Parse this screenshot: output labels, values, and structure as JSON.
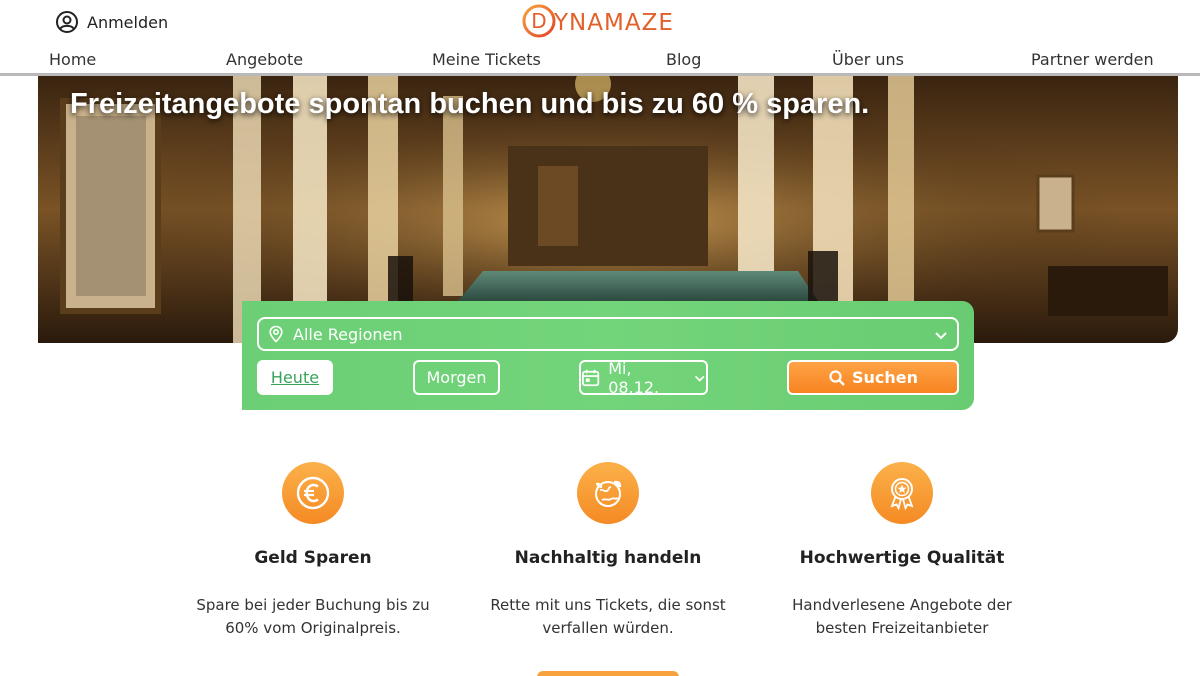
{
  "header": {
    "login_label": "Anmelden",
    "logo_text": "YNAMAZE",
    "logo_initial": "D"
  },
  "nav": {
    "items": [
      {
        "label": "Home",
        "active": true
      },
      {
        "label": "Angebote"
      },
      {
        "label": "Meine Tickets"
      },
      {
        "label": "Blog"
      },
      {
        "label": "Über uns"
      },
      {
        "label": "Partner werden"
      }
    ]
  },
  "hero": {
    "title": "Freizeitangebote spontan buchen und bis zu 60 % sparen."
  },
  "search": {
    "region_value": "Alle Regionen",
    "today_label": "Heute",
    "tomorrow_label": "Morgen",
    "date_label": "Mi, 08.12.",
    "search_label": "Suchen"
  },
  "features": [
    {
      "title": "Geld Sparen",
      "text_line1": "Spare bei jeder Buchung bis zu",
      "text_line2": "60% vom Originalpreis.",
      "icon": "euro-icon"
    },
    {
      "title": "Nachhaltig handeln",
      "text_line1": "Rette mit uns Tickets, die sonst",
      "text_line2": "verfallen würden.",
      "icon": "globe-leaf-icon"
    },
    {
      "title": "Hochwertige Qualität",
      "text_line1": "Handverlesene Angebote der",
      "text_line2": "besten Freizeitanbieter",
      "icon": "award-icon"
    }
  ],
  "colors": {
    "accent_orange": "#f7a23c",
    "search_green": "#6ccf75"
  }
}
